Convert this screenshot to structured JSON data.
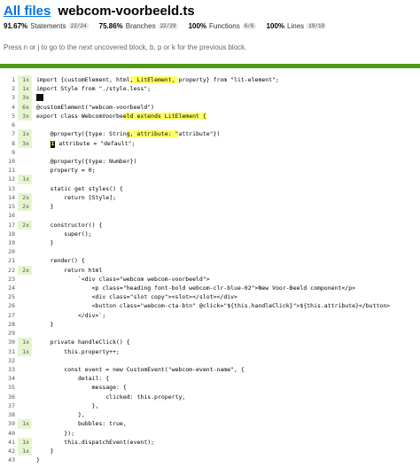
{
  "header": {
    "all_files_label": "All files",
    "file_name": "webcom-voorbeeld.ts",
    "hint": "Press n or j to go to the next uncovered block, b, p or k for the previous block."
  },
  "stats": [
    {
      "pct": "91.67%",
      "label": "Statements",
      "frac": "22/24"
    },
    {
      "pct": "75.86%",
      "label": "Branches",
      "frac": "22/29"
    },
    {
      "pct": "100%",
      "label": "Functions",
      "frac": "6/6"
    },
    {
      "pct": "100%",
      "label": "Lines",
      "frac": "19/19"
    }
  ],
  "colors": {
    "coverage_bar": "#4f9a15",
    "hit_bg": "#e6f5d0",
    "highlight": "#ffff66",
    "link": "#0074d9"
  },
  "code": [
    {
      "n": "1",
      "c": "1x",
      "p": [
        {
          "t": "import {customElement, html"
        },
        {
          "t": ", LitElement, ",
          "h": 1
        },
        {
          "t": "property} from \"lit-element\";"
        }
      ]
    },
    {
      "n": "2",
      "c": "1x",
      "p": [
        {
          "t": "import Style from \"./style.less\";"
        }
      ]
    },
    {
      "n": "3",
      "c": "3x",
      "p": [
        {
          "k": "empty"
        }
      ]
    },
    {
      "n": "4",
      "c": "6x",
      "p": [
        {
          "t": "@customElement(\"webcom-voorbeeld\")"
        }
      ]
    },
    {
      "n": "5",
      "c": "3x",
      "p": [
        {
          "t": "export class WebcomVoorbe"
        },
        {
          "t": "eld extends LitElement {",
          "h": 1
        }
      ]
    },
    {
      "n": "6",
      "c": "",
      "p": [
        {
          "t": ""
        }
      ]
    },
    {
      "n": "7",
      "c": "1x",
      "p": [
        {
          "t": "    @property({type: Strin"
        },
        {
          "t": "g, attribute: \"",
          "h": 1
        },
        {
          "t": "attribute\"})"
        }
      ]
    },
    {
      "n": "8",
      "c": "3x",
      "p": [
        {
          "t": "    "
        },
        {
          "k": "tok",
          "t": "I"
        },
        {
          "t": " attribute = \"default\";"
        }
      ]
    },
    {
      "n": "9",
      "c": "",
      "p": [
        {
          "t": ""
        }
      ]
    },
    {
      "n": "10",
      "c": "",
      "p": [
        {
          "t": "    @property({type: Number})"
        }
      ]
    },
    {
      "n": "11",
      "c": "",
      "p": [
        {
          "t": "    property = 0;"
        }
      ]
    },
    {
      "n": "12",
      "c": "1x",
      "p": [
        {
          "t": ""
        }
      ]
    },
    {
      "n": "13",
      "c": "",
      "p": [
        {
          "t": "    static get styles() {"
        }
      ]
    },
    {
      "n": "14",
      "c": "2x",
      "p": [
        {
          "t": "        return [Style];"
        }
      ]
    },
    {
      "n": "15",
      "c": "2x",
      "p": [
        {
          "t": "    }"
        }
      ]
    },
    {
      "n": "16",
      "c": "",
      "p": [
        {
          "t": ""
        }
      ]
    },
    {
      "n": "17",
      "c": "2x",
      "p": [
        {
          "t": "    constructor() {"
        }
      ]
    },
    {
      "n": "18",
      "c": "",
      "p": [
        {
          "t": "        super();"
        }
      ]
    },
    {
      "n": "19",
      "c": "",
      "p": [
        {
          "t": "    }"
        }
      ]
    },
    {
      "n": "20",
      "c": "",
      "p": [
        {
          "t": ""
        }
      ]
    },
    {
      "n": "21",
      "c": "",
      "p": [
        {
          "t": "    render() {"
        }
      ]
    },
    {
      "n": "22",
      "c": "2x",
      "p": [
        {
          "t": "        return html"
        }
      ]
    },
    {
      "n": "23",
      "c": "",
      "p": [
        {
          "t": "            `<div class=\"webcom webcom-voorbeeld\">"
        }
      ]
    },
    {
      "n": "24",
      "c": "",
      "p": [
        {
          "t": "                <p class=\"heading font-bold webcom-clr-blue-02\">New Voor-Beeld component</p>"
        }
      ]
    },
    {
      "n": "25",
      "c": "",
      "p": [
        {
          "t": "                <div class=\"slot copy\"><slot></slot></div>"
        }
      ]
    },
    {
      "n": "26",
      "c": "",
      "p": [
        {
          "t": "                <button class=\"webcom-cta-btn\" @click=\"${this.handleClick}\">${this.attribute}</button>"
        }
      ]
    },
    {
      "n": "27",
      "c": "",
      "p": [
        {
          "t": "            </div>`;"
        }
      ]
    },
    {
      "n": "28",
      "c": "",
      "p": [
        {
          "t": "    }"
        }
      ]
    },
    {
      "n": "29",
      "c": "",
      "p": [
        {
          "t": ""
        }
      ]
    },
    {
      "n": "30",
      "c": "1x",
      "p": [
        {
          "t": "    private handleClick() {"
        }
      ]
    },
    {
      "n": "31",
      "c": "1x",
      "p": [
        {
          "t": "        this.property++;"
        }
      ]
    },
    {
      "n": "32",
      "c": "",
      "p": [
        {
          "t": ""
        }
      ]
    },
    {
      "n": "33",
      "c": "",
      "p": [
        {
          "t": "        const event = new CustomEvent(\"webcom-event-name\", {"
        }
      ]
    },
    {
      "n": "34",
      "c": "",
      "p": [
        {
          "t": "            detail: {"
        }
      ]
    },
    {
      "n": "35",
      "c": "",
      "p": [
        {
          "t": "                message: {"
        }
      ]
    },
    {
      "n": "36",
      "c": "",
      "p": [
        {
          "t": "                    clicked: this.property,"
        }
      ]
    },
    {
      "n": "37",
      "c": "",
      "p": [
        {
          "t": "                },"
        }
      ]
    },
    {
      "n": "38",
      "c": "",
      "p": [
        {
          "t": "            },"
        }
      ]
    },
    {
      "n": "39",
      "c": "1x",
      "p": [
        {
          "t": "            bubbles: true,"
        }
      ]
    },
    {
      "n": "40",
      "c": "",
      "p": [
        {
          "t": "        });"
        }
      ]
    },
    {
      "n": "41",
      "c": "1x",
      "p": [
        {
          "t": "        this.dispatchEvent(event);"
        }
      ]
    },
    {
      "n": "42",
      "c": "1x",
      "p": [
        {
          "t": "    }"
        }
      ]
    },
    {
      "n": "43",
      "c": "",
      "p": [
        {
          "t": "}"
        }
      ]
    }
  ]
}
